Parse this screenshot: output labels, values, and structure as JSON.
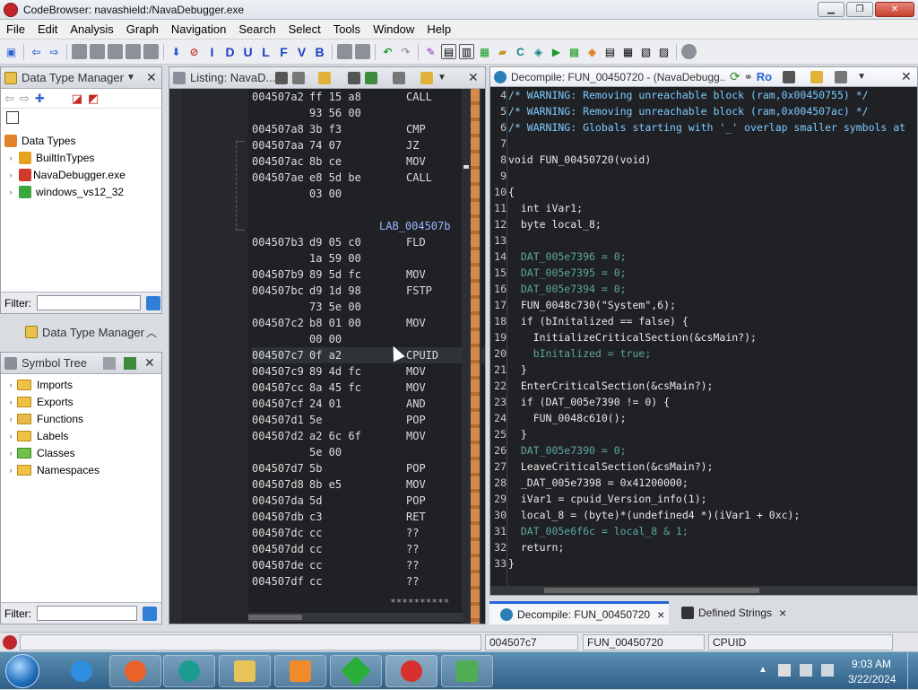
{
  "window": {
    "title": "CodeBrowser: navashield:/NavaDebugger.exe",
    "btn_min": "▁",
    "btn_max": "❐",
    "btn_close": "✕"
  },
  "menu": [
    "File",
    "Edit",
    "Analysis",
    "Graph",
    "Navigation",
    "Search",
    "Select",
    "Tools",
    "Window",
    "Help"
  ],
  "toolbar_letters": [
    "I",
    "D",
    "U",
    "L",
    "F",
    "V",
    "B"
  ],
  "data_type_manager": {
    "title": "Data Type Manager",
    "root": "Data Types",
    "items": [
      "BuiltInTypes",
      "NavaDebugger.exe",
      "windows_vs12_32"
    ],
    "filter_label": "Filter:",
    "collapsed_title": "Data Type Manager"
  },
  "symbol_tree": {
    "title": "Symbol Tree",
    "items": [
      "Imports",
      "Exports",
      "Functions",
      "Labels",
      "Classes",
      "Namespaces"
    ],
    "filter_label": "Filter:"
  },
  "listing": {
    "title": "Listing:  NavaD...",
    "rows": [
      {
        "addr": "004507a2",
        "bytes": "ff 15 a8",
        "mn": "CALL"
      },
      {
        "addr": "",
        "bytes": "93 56 00",
        "mn": ""
      },
      {
        "addr": "004507a8",
        "bytes": "3b f3",
        "mn": "CMP"
      },
      {
        "addr": "004507aa",
        "bytes": "74 07",
        "mn": "JZ"
      },
      {
        "addr": "004507ac",
        "bytes": "8b ce",
        "mn": "MOV"
      },
      {
        "addr": "004507ae",
        "bytes": "e8 5d be",
        "mn": "CALL"
      },
      {
        "addr": "",
        "bytes": "03 00",
        "mn": ""
      },
      {
        "addr": "",
        "bytes": "",
        "mn": ""
      },
      {
        "addr": "",
        "bytes": "",
        "mn": "LAB_004507b"
      },
      {
        "addr": "004507b3",
        "bytes": "d9 05 c0",
        "mn": "FLD"
      },
      {
        "addr": "",
        "bytes": "1a 59 00",
        "mn": ""
      },
      {
        "addr": "004507b9",
        "bytes": "89 5d fc",
        "mn": "MOV"
      },
      {
        "addr": "004507bc",
        "bytes": "d9 1d 98",
        "mn": "FSTP"
      },
      {
        "addr": "",
        "bytes": "73 5e 00",
        "mn": ""
      },
      {
        "addr": "004507c2",
        "bytes": "b8 01 00",
        "mn": "MOV"
      },
      {
        "addr": "",
        "bytes": "00 00",
        "mn": ""
      },
      {
        "addr": "004507c7",
        "bytes": "0f a2",
        "mn": "CPUID"
      },
      {
        "addr": "004507c9",
        "bytes": "89 4d fc",
        "mn": "MOV"
      },
      {
        "addr": "004507cc",
        "bytes": "8a 45 fc",
        "mn": "MOV"
      },
      {
        "addr": "004507cf",
        "bytes": "24 01",
        "mn": "AND"
      },
      {
        "addr": "004507d1",
        "bytes": "5e",
        "mn": "POP"
      },
      {
        "addr": "004507d2",
        "bytes": "a2 6c 6f",
        "mn": "MOV"
      },
      {
        "addr": "",
        "bytes": "5e 00",
        "mn": ""
      },
      {
        "addr": "004507d7",
        "bytes": "5b",
        "mn": "POP"
      },
      {
        "addr": "004507d8",
        "bytes": "8b e5",
        "mn": "MOV"
      },
      {
        "addr": "004507da",
        "bytes": "5d",
        "mn": "POP"
      },
      {
        "addr": "004507db",
        "bytes": "c3",
        "mn": "RET"
      },
      {
        "addr": "004507dc",
        "bytes": "cc",
        "mn": "??"
      },
      {
        "addr": "004507dd",
        "bytes": "cc",
        "mn": "??"
      },
      {
        "addr": "004507de",
        "bytes": "cc",
        "mn": "??"
      },
      {
        "addr": "004507df",
        "bytes": "cc",
        "mn": "??"
      }
    ],
    "footer": "**********"
  },
  "decompile": {
    "title": "Decompile: FUN_00450720 -  (NavaDebugg...",
    "title_ro": "Ro",
    "lines": [
      {
        "n": "4",
        "t": "/* WARNING: Removing unreachable block (ram,0x00450755) */",
        "c": "c-cmt"
      },
      {
        "n": "5",
        "t": "/* WARNING: Removing unreachable block (ram,0x004507ac) */",
        "c": "c-cmt"
      },
      {
        "n": "6",
        "t": "/* WARNING: Globals starting with '_' overlap smaller symbols at",
        "c": "c-cmt"
      },
      {
        "n": "7",
        "t": "",
        "c": ""
      },
      {
        "n": "8",
        "t": "void FUN_00450720(void)",
        "c": "c-kw"
      },
      {
        "n": "9",
        "t": "",
        "c": ""
      },
      {
        "n": "10",
        "t": "{",
        "c": "c-kw"
      },
      {
        "n": "11",
        "t": "  int iVar1;",
        "c": "c-kw"
      },
      {
        "n": "12",
        "t": "  byte local_8;",
        "c": "c-kw"
      },
      {
        "n": "13",
        "t": "",
        "c": ""
      },
      {
        "n": "14",
        "t": "  DAT_005e7396 = 0;",
        "c": "c-var"
      },
      {
        "n": "15",
        "t": "  DAT_005e7395 = 0;",
        "c": "c-var"
      },
      {
        "n": "16",
        "t": "  DAT_005e7394 = 0;",
        "c": "c-var"
      },
      {
        "n": "17",
        "t": "  FUN_0048c730(\"System\",6);",
        "c": "c-fn"
      },
      {
        "n": "18",
        "t": "  if (bInitalized == false) {",
        "c": "c-kw"
      },
      {
        "n": "19",
        "t": "    InitializeCriticalSection(&csMain?);",
        "c": "c-fn"
      },
      {
        "n": "20",
        "t": "    bInitalized = true;",
        "c": "c-var"
      },
      {
        "n": "21",
        "t": "  }",
        "c": "c-kw"
      },
      {
        "n": "22",
        "t": "  EnterCriticalSection(&csMain?);",
        "c": "c-fn"
      },
      {
        "n": "23",
        "t": "  if (DAT_005e7390 != 0) {",
        "c": "c-kw"
      },
      {
        "n": "24",
        "t": "    FUN_0048c610();",
        "c": "c-fn"
      },
      {
        "n": "25",
        "t": "  }",
        "c": "c-kw"
      },
      {
        "n": "26",
        "t": "  DAT_005e7390 = 0;",
        "c": "c-var"
      },
      {
        "n": "27",
        "t": "  LeaveCriticalSection(&csMain?);",
        "c": "c-fn"
      },
      {
        "n": "28",
        "t": "  _DAT_005e7398 = 0x41200000;",
        "c": "c-kw"
      },
      {
        "n": "29",
        "t": "  iVar1 = cpuid_Version_info(1);",
        "c": "c-kw"
      },
      {
        "n": "30",
        "t": "  local_8 = (byte)*(undefined4 *)(iVar1 + 0xc);",
        "c": "c-kw"
      },
      {
        "n": "31",
        "t": "  DAT_005e6f6c = local_8 & 1;",
        "c": "c-var"
      },
      {
        "n": "32",
        "t": "  return;",
        "c": "c-kw"
      },
      {
        "n": "33",
        "t": "}",
        "c": "c-kw"
      }
    ]
  },
  "bottom_tabs": {
    "decompile": "Decompile: FUN_00450720",
    "defined_strings": "Defined Strings",
    "close": "×"
  },
  "status": {
    "address": "004507c7",
    "function": "FUN_00450720",
    "instruction": "CPUID"
  },
  "taskbar": {
    "time": "9:03 AM",
    "date": "3/22/2024"
  },
  "colors": {
    "accent": "#2a63d6",
    "code_bg": "#1f2124",
    "comment": "#7ecbff",
    "global_var": "#5fa6a3"
  }
}
